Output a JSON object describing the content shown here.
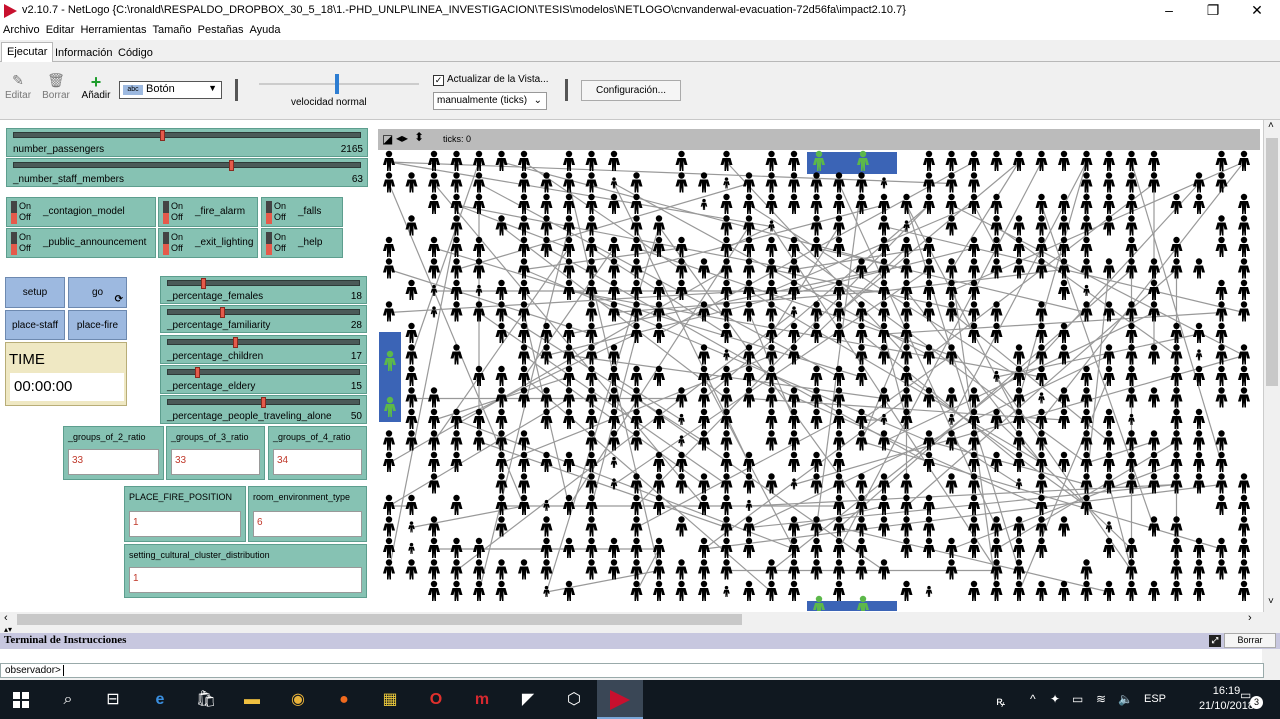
{
  "window": {
    "title": "v2.10.7 - NetLogo {C:\\ronald\\RESPALDO_DROPBOX_30_5_18\\1.-PHD_UNLP\\LINEA_INVESTIGACION\\TESIS\\modelos\\NETLOGO\\cnvanderwal-evacuation-72d56fa\\impact2.10.7}",
    "minimize": "–",
    "maximize": "❐",
    "close": "✕"
  },
  "menu": [
    "Archivo",
    "Editar",
    "Herramientas",
    "Tamaño",
    "Pestañas",
    "Ayuda"
  ],
  "tabs": [
    "Ejecutar",
    "Información",
    "Código"
  ],
  "toolbar": {
    "edit": "Editar",
    "delete": "Borrar",
    "add": "Añadir",
    "widget_type": "Botón",
    "speed_label": "velocidad normal",
    "update_view": "Actualizar de la Vista...",
    "update_mode": "manualmente (ticks)",
    "settings": "Configuración..."
  },
  "sliders": {
    "number_passengers": {
      "label": "number_passengers",
      "value": "2165",
      "pct": 0.43
    },
    "number_staff": {
      "label": "_number_staff_members",
      "value": "63",
      "pct": 0.63
    },
    "females": {
      "label": "_percentage_females",
      "value": "18",
      "pct": 0.18
    },
    "familiarity": {
      "label": "_percentage_familiarity",
      "value": "28",
      "pct": 0.28
    },
    "children": {
      "label": "_percentage_children",
      "value": "17",
      "pct": 0.35
    },
    "eldery": {
      "label": "_percentage_eldery",
      "value": "15",
      "pct": 0.15
    },
    "alone": {
      "label": "_percentage_people_traveling_alone",
      "value": "50",
      "pct": 0.5
    }
  },
  "switches": {
    "on": "On",
    "off": "Off",
    "contagion": "_contagion_model",
    "fire_alarm": "_fire_alarm",
    "falls": "_falls",
    "public_announcement": "_public_announcement",
    "exit_lighting": "_exit_lighting",
    "help": "_help"
  },
  "buttons": {
    "setup": "setup",
    "go": "go",
    "place_staff": "place-staff",
    "place_fire": "place-fire"
  },
  "monitor": {
    "label": "TIME",
    "value": "00:00:00"
  },
  "inputs": {
    "g2": {
      "label": "_groups_of_2_ratio",
      "value": "33"
    },
    "g3": {
      "label": "_groups_of_3_ratio",
      "value": "33"
    },
    "g4": {
      "label": "_groups_of_4_ratio",
      "value": "34"
    },
    "fire_pos": {
      "label": "PLACE_FIRE_POSITION",
      "value": "1"
    },
    "room_env": {
      "label": "room_environment_type",
      "value": "6"
    },
    "cultural": {
      "label": "setting_cultural_cluster_distribution",
      "value": "1"
    }
  },
  "view": {
    "ticks": "ticks: 0"
  },
  "command_center": {
    "title": "Terminal de Instrucciones",
    "clear": "Borrar",
    "prompt": "observador>"
  },
  "taskbar": {
    "time": "16:19",
    "date": "21/10/2018",
    "lang": "ESP",
    "notifications": "3"
  },
  "colors": {
    "slider": "#86c2b3",
    "button": "#9db9e0",
    "monitor": "#efe8c3",
    "exit": "#3b64b6",
    "staff": "#5cb84a"
  }
}
